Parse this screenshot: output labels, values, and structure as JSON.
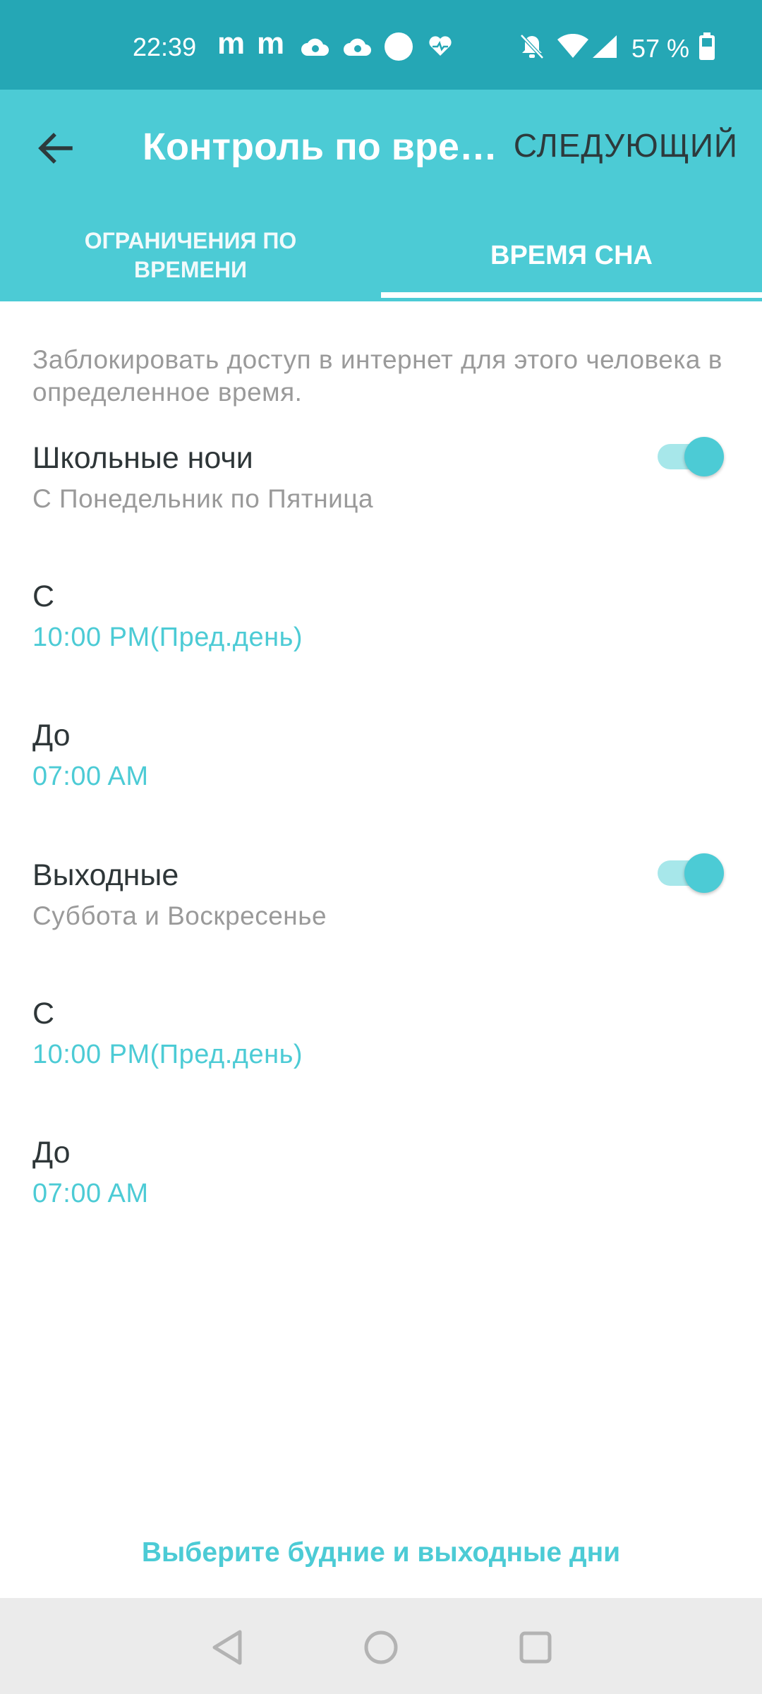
{
  "status_bar": {
    "time": "22:39",
    "notif_letter_1": "m",
    "notif_letter_2": "m",
    "battery_text": "57 %",
    "icons": [
      "cloud-icon",
      "cloud-icon",
      "circle-icon",
      "heart-icon",
      "bell-off-icon",
      "wifi-icon",
      "signal-icon",
      "battery-icon"
    ]
  },
  "app_bar": {
    "title": "Контроль по вре…",
    "next_label": "СЛЕДУЮЩИЙ",
    "color": "#4ccbd5"
  },
  "tabs": [
    {
      "label_line1": "ОГРАНИЧЕНИЯ ПО",
      "label_line2": "ВРЕМЕНИ",
      "selected": false
    },
    {
      "label": "ВРЕМЯ СНА",
      "selected": true
    }
  ],
  "description": "Заблокировать доступ в интернет для этого человека в определенное время.",
  "school_nights": {
    "label": "Школьные ночи",
    "days": "С Понедельник по Пятница",
    "enabled": true,
    "from_label": "С",
    "from_value": "10:00 PM(Пред.день)",
    "to_label": "До",
    "to_value": "07:00 AM"
  },
  "weekend": {
    "label": "Выходные",
    "days": "Суббота и Воскресенье",
    "enabled": true,
    "from_label": "С",
    "from_value": "10:00 PM(Пред.день)",
    "to_label": "До",
    "to_value": "07:00 AM"
  },
  "footer_link": "Выберите будние и выходные дни",
  "nav_bar": {
    "icons": [
      "back-triangle-icon",
      "home-circle-icon",
      "recents-square-icon"
    ]
  }
}
